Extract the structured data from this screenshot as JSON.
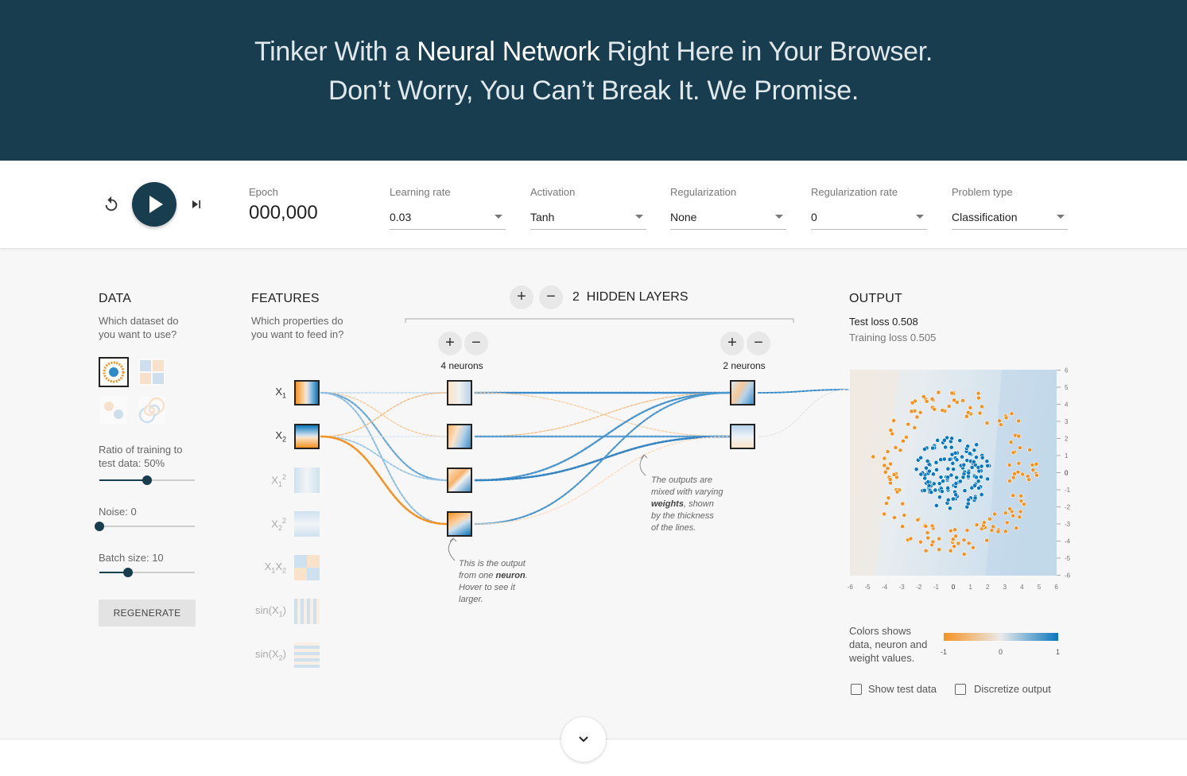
{
  "header": {
    "line1_pre": "Tinker With a ",
    "line1_bold": "Neural Network",
    "line1_post": " Right Here in Your Browser.",
    "line2": "Don’t Worry, You Can’t Break It. We Promise."
  },
  "controls": {
    "epoch_label": "Epoch",
    "epoch_value": "000,000",
    "learning_rate": {
      "label": "Learning rate",
      "value": "0.03"
    },
    "activation": {
      "label": "Activation",
      "value": "Tanh"
    },
    "regularization": {
      "label": "Regularization",
      "value": "None"
    },
    "regularization_rate": {
      "label": "Regularization rate",
      "value": "0"
    },
    "problem_type": {
      "label": "Problem type",
      "value": "Classification"
    }
  },
  "data_panel": {
    "title": "DATA",
    "subtitle_1": "Which dataset do",
    "subtitle_2": "you want to use?",
    "ratio_label_1": "Ratio of training to",
    "ratio_label_2": "test data:  50%",
    "ratio_value": 0.5,
    "noise_label": "Noise:  0",
    "noise_value": 0,
    "batch_label": "Batch size:  10",
    "batch_value": 0.3,
    "regenerate": "REGENERATE"
  },
  "features_panel": {
    "title": "FEATURES",
    "subtitle_1": "Which properties do",
    "subtitle_2": "you want to feed in?"
  },
  "network": {
    "layer_count": "2",
    "layers_label": "HIDDEN LAYERS",
    "layer1_neurons": "4 neurons",
    "layer2_neurons": "2 neurons",
    "note1_1": "This is the output",
    "note1_2a": "from one ",
    "note1_2b": "neuron",
    "note1_3": "Hover to see it",
    "note1_4": "larger.",
    "note2_1": "The outputs are",
    "note2_2": "mixed with varying",
    "note2_3a": "weights",
    "note2_3b": ", shown",
    "note2_4": "by the thickness",
    "note2_5": "of the lines."
  },
  "output_panel": {
    "title": "OUTPUT",
    "test_loss": "Test loss 0.508",
    "training_loss": "Training loss 0.505",
    "legend_text": "Colors shows data, neuron and weight values.",
    "legend_min": "-1",
    "legend_mid": "0",
    "legend_max": "1",
    "show_test_data": "Show test data",
    "discretize_output": "Discretize output"
  },
  "colors": {
    "brand_dark": "#183d4e",
    "orange": "#f59322",
    "blue": "#0877bd"
  }
}
